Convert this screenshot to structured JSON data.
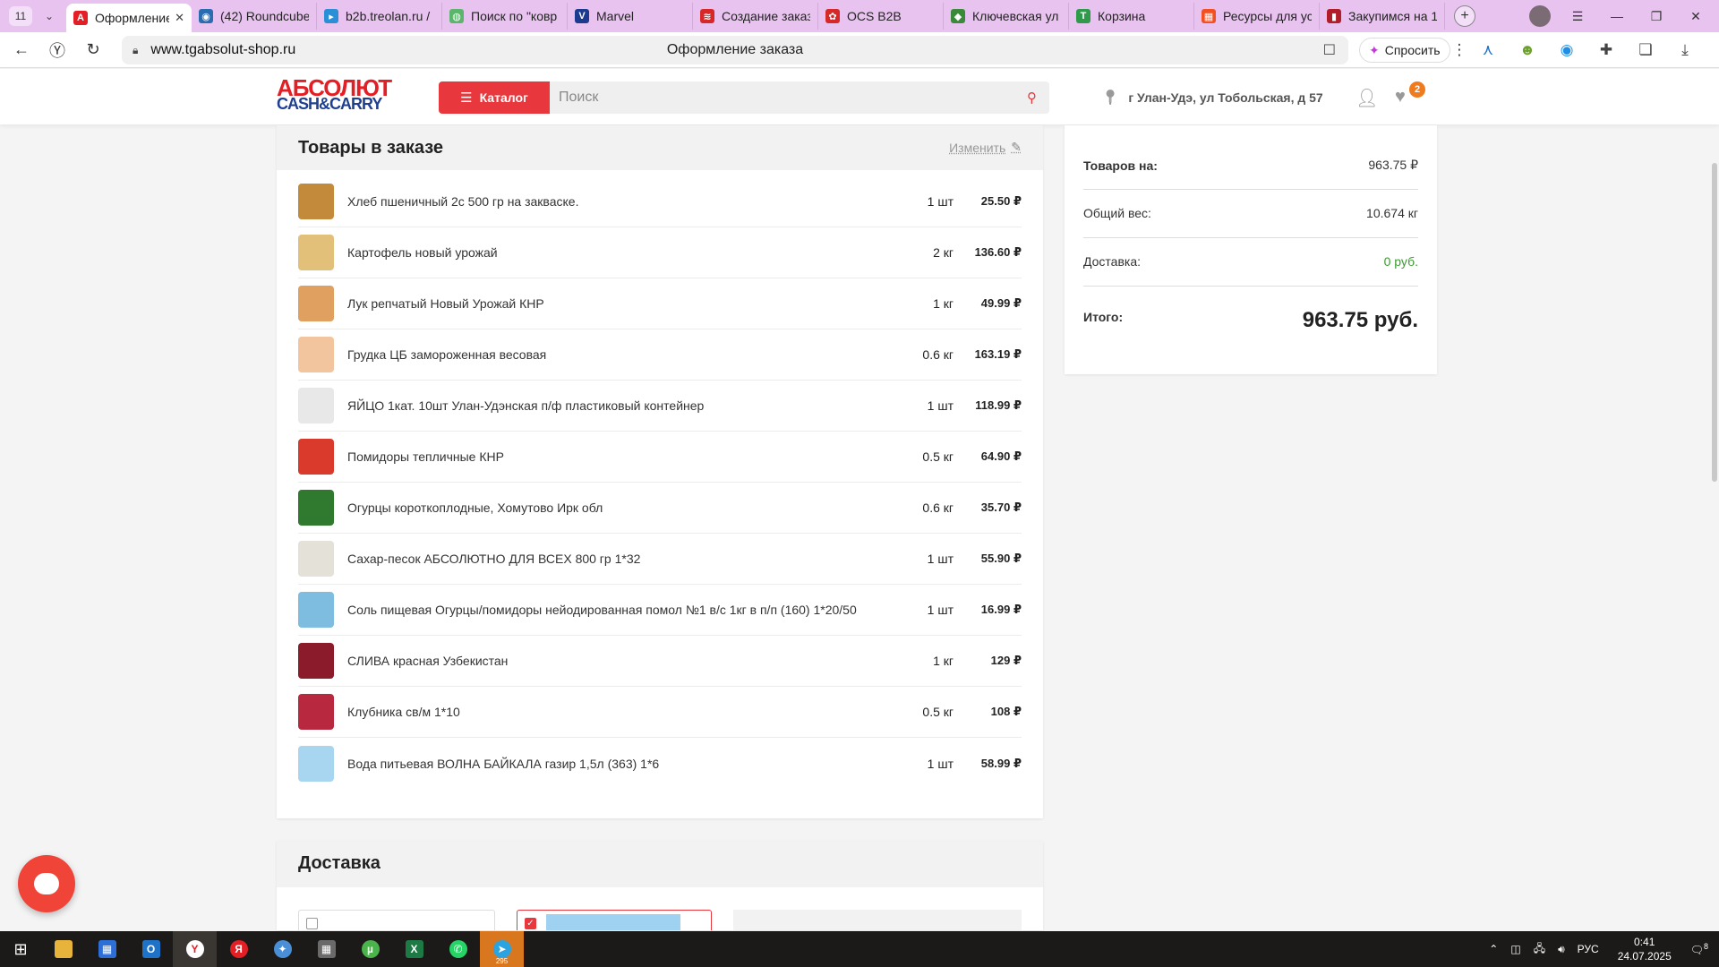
{
  "browser": {
    "tab_count": "11",
    "tabs": [
      {
        "title": "Оформление",
        "icon": "A",
        "color": "#e31e24",
        "active": true
      },
      {
        "title": "(42) Roundcube",
        "icon": "◉",
        "color": "#2b6cb0",
        "active": false
      },
      {
        "title": "b2b.treolan.ru /",
        "icon": "▸",
        "color": "#2b8fd6",
        "active": false
      },
      {
        "title": "Поиск по \"ковр",
        "icon": "◍",
        "color": "#5bb56b",
        "active": false
      },
      {
        "title": "Marvel",
        "icon": "V",
        "color": "#1c3b8f",
        "active": false
      },
      {
        "title": "Создание заказ",
        "icon": "≋",
        "color": "#d62828",
        "active": false
      },
      {
        "title": "OCS B2B",
        "icon": "✿",
        "color": "#d62828",
        "active": false
      },
      {
        "title": "Ключевская ул",
        "icon": "◆",
        "color": "#3a8a3a",
        "active": false
      },
      {
        "title": "Корзина",
        "icon": "T",
        "color": "#2e9a4a",
        "active": false
      },
      {
        "title": "Ресурсы для ус",
        "icon": "▦",
        "color": "#f25022",
        "active": false
      },
      {
        "title": "Закупимся на 1",
        "icon": "▮",
        "color": "#b01e2a",
        "active": false
      }
    ],
    "url": "www.tgabsolut-shop.ru",
    "page_title": "Оформление заказа",
    "ask_label": "Спросить"
  },
  "header": {
    "logo_line1": "АБСОЛЮТ",
    "logo_line2": "CASH&CARRY",
    "catalog_label": "Каталог",
    "search_placeholder": "Поиск",
    "location": "г Улан-Удэ, ул Тобольская, д 57",
    "cart_count": "2"
  },
  "order": {
    "title": "Товары в заказе",
    "edit_label": "Изменить",
    "items": [
      {
        "name": "Хлеб пшеничный 2с 500 гр на закваске.",
        "qty": "1 шт",
        "price": "25.50 ₽",
        "color": "#c48a3c"
      },
      {
        "name": "Картофель новый урожай",
        "qty": "2 кг",
        "price": "136.60 ₽",
        "color": "#e2c07a"
      },
      {
        "name": "Лук репчатый Новый Урожай КНР",
        "qty": "1 кг",
        "price": "49.99 ₽",
        "color": "#e0a060"
      },
      {
        "name": "Грудка ЦБ замороженная весовая",
        "qty": "0.6 кг",
        "price": "163.19 ₽",
        "color": "#f2c59e"
      },
      {
        "name": "ЯЙЦО 1кат. 10шт Улан-Удэнская п/ф пластиковый контейнер",
        "qty": "1 шт",
        "price": "118.99 ₽",
        "color": "#e8e8e8"
      },
      {
        "name": "Помидоры тепличные КНР",
        "qty": "0.5 кг",
        "price": "64.90 ₽",
        "color": "#d93a2b"
      },
      {
        "name": "Огурцы короткоплодные, Хомутово Ирк обл",
        "qty": "0.6 кг",
        "price": "35.70 ₽",
        "color": "#2f7a2f"
      },
      {
        "name": "Сахар-песок АБСОЛЮТНО ДЛЯ ВСЕХ 800 гр 1*32",
        "qty": "1 шт",
        "price": "55.90 ₽",
        "color": "#e4e1d8"
      },
      {
        "name": "Соль пищевая Огурцы/помидоры нейодированная помол №1 в/с 1кг в п/п (160) 1*20/50",
        "qty": "1 шт",
        "price": "16.99 ₽",
        "color": "#7fbde0"
      },
      {
        "name": "СЛИВА красная Узбекистан",
        "qty": "1 кг",
        "price": "129 ₽",
        "color": "#8b1a2a"
      },
      {
        "name": "Клубника св/м 1*10",
        "qty": "0.5 кг",
        "price": "108 ₽",
        "color": "#b8283f"
      },
      {
        "name": "Вода питьевая ВОЛНА БАЙКАЛА газир 1,5л (363) 1*6",
        "qty": "1 шт",
        "price": "58.99 ₽",
        "color": "#a8d6f0"
      }
    ]
  },
  "summary": {
    "goods_label": "Товаров на:",
    "goods_value": "963.75 ₽",
    "weight_label": "Общий вес:",
    "weight_value": "10.674 кг",
    "delivery_label": "Доставка:",
    "delivery_value": "0 руб.",
    "total_label": "Итого:",
    "total_value": "963.75 руб."
  },
  "delivery": {
    "title": "Доставка"
  },
  "taskbar": {
    "lang": "РУС",
    "time": "0:41",
    "date": "24.07.2025",
    "notif_count": "8",
    "telegram_badge": "295"
  }
}
